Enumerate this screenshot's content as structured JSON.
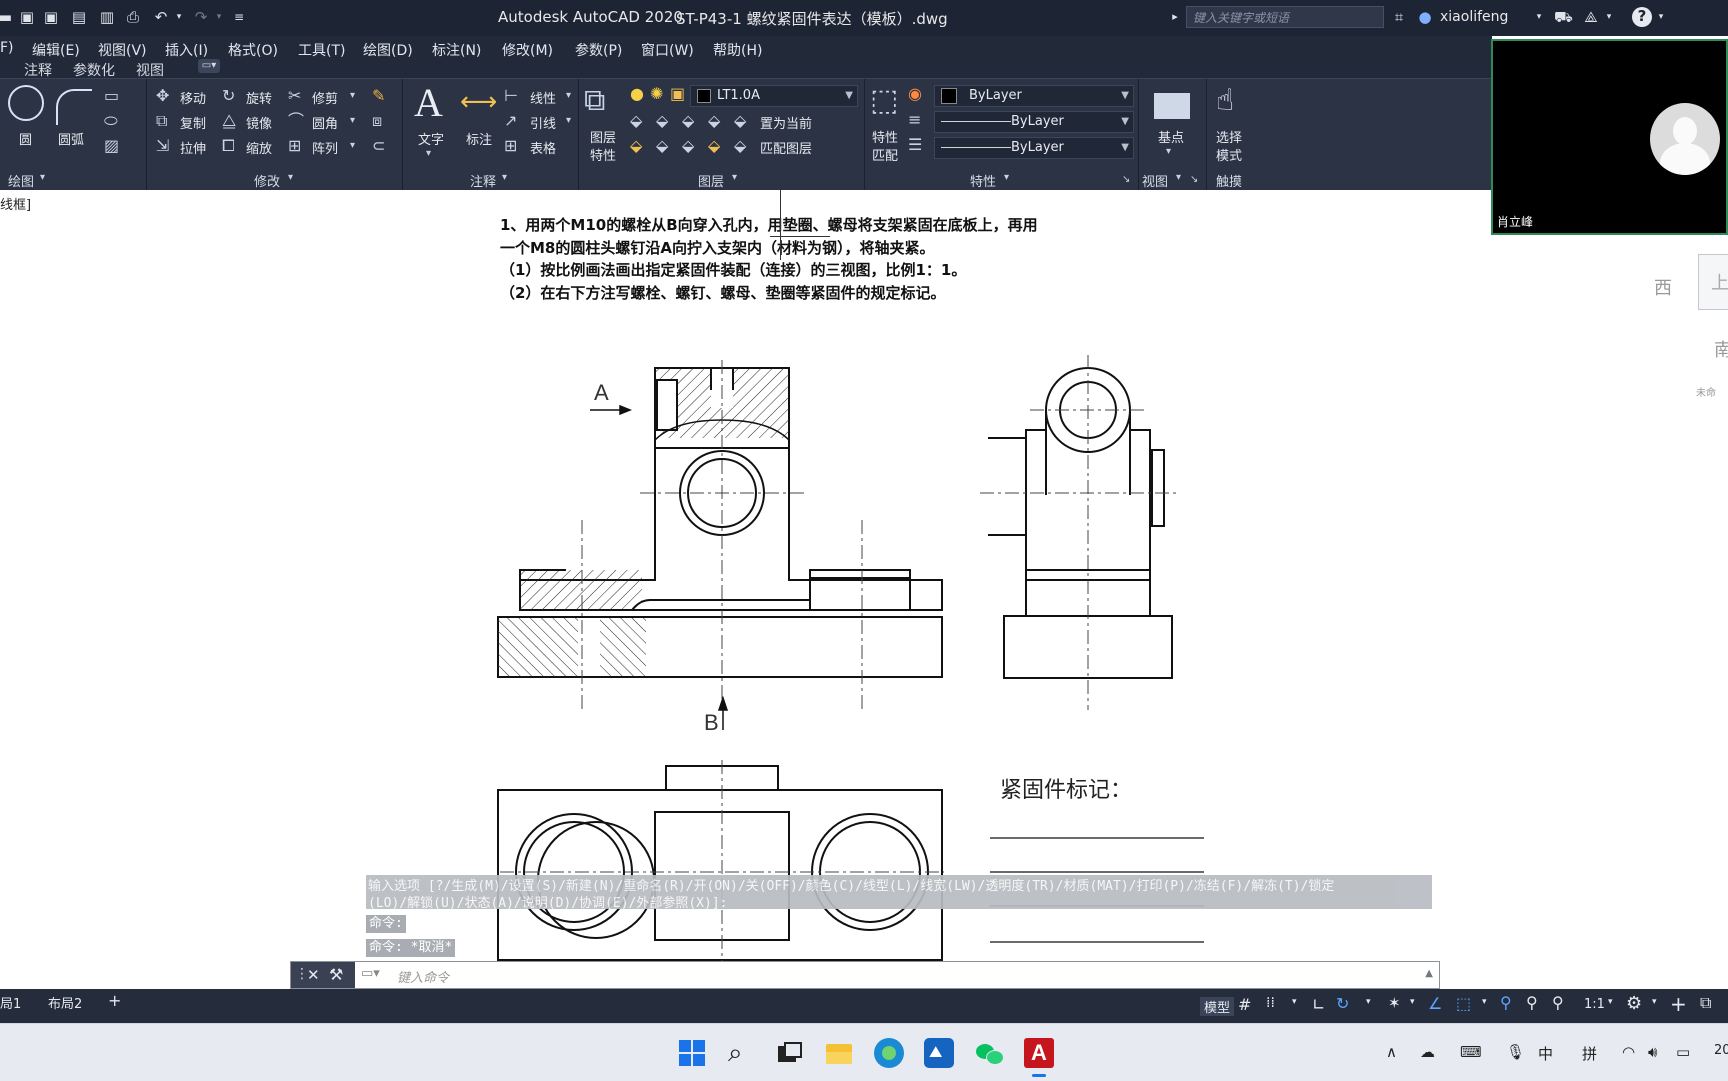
{
  "titlebar": {
    "app_title": "Autodesk AutoCAD 2020",
    "file_title": "ST-P43-1 螺纹紧固件表达（模板）.dwg",
    "search_placeholder": "键入关键字或短语",
    "username": "xiaolifeng"
  },
  "menubar": {
    "items": [
      "F)",
      "编辑(E)",
      "视图(V)",
      "插入(I)",
      "格式(O)",
      "工具(T)",
      "绘图(D)",
      "标注(N)",
      "修改(M)",
      "参数(P)",
      "窗口(W)",
      "帮助(H)"
    ]
  },
  "ribbon_tabs": [
    "注释",
    "参数化",
    "视图"
  ],
  "ribbon": {
    "draw": {
      "circle": "圆",
      "arc": "圆弧",
      "panel": "绘图"
    },
    "modify": {
      "move": "移动",
      "rotate": "旋转",
      "trim": "修剪",
      "copy": "复制",
      "mirror": "镜像",
      "fillet": "圆角",
      "stretch": "拉伸",
      "scale": "缩放",
      "array": "阵列",
      "panel": "修改"
    },
    "annotation": {
      "text": "文字",
      "dimension": "标注",
      "linear": "线性",
      "leader": "引线",
      "table": "表格",
      "panel": "注释"
    },
    "layers": {
      "layer_props_1": "图层",
      "layer_props_2": "特性",
      "current_layer": "LT1.0A",
      "set_current": "置为当前",
      "match_layer": "匹配图层",
      "panel": "图层"
    },
    "properties": {
      "match_1": "特性",
      "match_2": "匹配",
      "color": "ByLayer",
      "linetype": "ByLayer",
      "lineweight": "ByLayer",
      "panel": "特性"
    },
    "view": {
      "base": "基点",
      "panel": "视图"
    },
    "touch": {
      "select_1": "选择",
      "select_2": "模式",
      "panel": "触摸"
    }
  },
  "webcam": {
    "name": "肖立峰"
  },
  "viewport_label": "线框]",
  "right_panel": {
    "label1": "西",
    "label2": "上",
    "label3": "南",
    "label4": "未命"
  },
  "drawing": {
    "instructions": [
      "1、用两个M10的螺栓从B向穿入孔内，用垫圈、螺母将支架紧固在底板上，再用",
      "一个M8的圆柱头螺钉沿A向拧入支架内（材料为钢），将轴夹紧。",
      "（1）按比例画法画出指定紧固件装配（连接）的三视图，比例1：1。",
      "（2）在右下方注写螺栓、螺钉、螺母、垫圈等紧固件的规定标记。"
    ],
    "label_a": "A",
    "label_b": "B",
    "fastener_title": "紧固件标记："
  },
  "command": {
    "history_line1": "输入选项 [?/生成(M)/设置(S)/新建(N)/重命名(R)/开(ON)/关(OFF)/颜色(C)/线型(L)/线宽(LW)/透明度(TR)/材质(MAT)/打印(P)/冻结(F)/解冻(T)/锁定",
    "history_line2": "(LO)/解锁(U)/状态(A)/说明(D)/协调(E)/外部参照(X)]:",
    "history_line3": "命令:",
    "history_line4": "命令: *取消*",
    "input_placeholder": "键入命令"
  },
  "statusbar": {
    "layout1": "局1",
    "layout2": "布局2",
    "add_tab": "+",
    "model": "模型",
    "scale": "1:1"
  },
  "taskbar": {
    "ime_lang": "中",
    "ime_mode": "拼",
    "clock_partial": "20"
  }
}
